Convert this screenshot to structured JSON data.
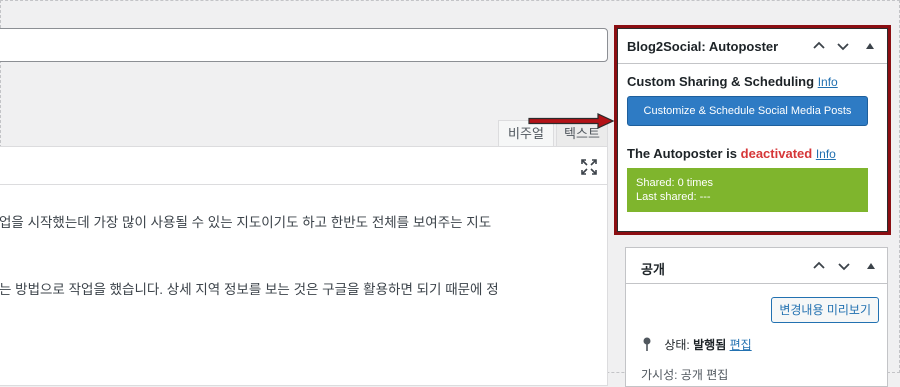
{
  "editor": {
    "tabs": {
      "visual": "비주얼",
      "text": "텍스트"
    },
    "lines": [
      "업을 시작했는데 가장 많이 사용될 수 있는 지도이기도 하고 한반도 전체를 보여주는 지도",
      "는 방법으로 작업을 했습니다. 상세 지역 정보를 보는 것은 구글을 활용하면 되기 때문에 정"
    ]
  },
  "b2s": {
    "title": "Blog2Social: Autoposter",
    "custom_label": "Custom Sharing & Scheduling",
    "info_label": "Info",
    "button_label": "Customize & Schedule Social Media Posts",
    "autoposter_prefix": "The Autoposter is",
    "autoposter_status": "deactivated",
    "autoposter_info": "Info",
    "shared_count": "Shared: 0 times",
    "last_shared": "Last shared: ---"
  },
  "publish": {
    "title": "공개",
    "preview_button": "변경내용 미리보기",
    "status_label": "상태:",
    "status_value": "발행됨",
    "status_edit": "편집",
    "visibility_cut": "가시성: 공개 편집"
  },
  "colors": {
    "highlight_border": "#8b0e12",
    "button_blue": "#2e7bc4",
    "shared_green": "#7fb52d",
    "deactivated_red": "#d63638",
    "link_blue": "#2271b1"
  }
}
